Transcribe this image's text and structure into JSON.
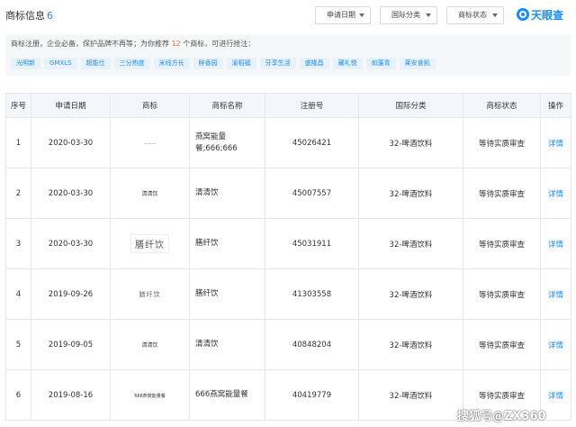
{
  "header": {
    "title": "商标信息",
    "count": "6",
    "filters": [
      {
        "label": "申请日期"
      },
      {
        "label": "国际分类"
      },
      {
        "label": "商标状态"
      }
    ],
    "logo_text": "天眼查"
  },
  "recommend": {
    "text_before": "商标注册，企业必备，保护品牌不再等；为你推荐",
    "count": "12",
    "text_after": "个商标，可进行抢注：",
    "tags": [
      "光明新",
      "GMXLS",
      "超能仕",
      "三分热度",
      "米线方长",
      "醉香园",
      "渝稻福",
      "芬享生活",
      "盛隆昌",
      "藏礼悦",
      "如蓬青",
      "莱安食凯"
    ]
  },
  "table": {
    "columns": [
      "序号",
      "申请日期",
      "商标",
      "商标名称",
      "注册号",
      "国际分类",
      "商标状态",
      "操作"
    ],
    "rows": [
      {
        "index": "1",
        "date": "2020-03-30",
        "mark": "···········",
        "name": "燕窝能量餐;666;666",
        "reg_no": "45026421",
        "category": "32-啤酒饮料",
        "status": "等待实质审查",
        "action": "详情"
      },
      {
        "index": "2",
        "date": "2020-03-30",
        "mark": "清清饮",
        "name": "清清饮",
        "reg_no": "45007557",
        "category": "32-啤酒饮料",
        "status": "等待实质审查",
        "action": "详情"
      },
      {
        "index": "3",
        "date": "2020-03-30",
        "mark": "膳纤饮",
        "name": "膳纤饮",
        "reg_no": "45031911",
        "category": "32-啤酒饮料",
        "status": "等待实质审查",
        "action": "详情"
      },
      {
        "index": "4",
        "date": "2019-09-26",
        "mark": "膳纤饮",
        "name": "膳纤饮",
        "reg_no": "41303558",
        "category": "32-啤酒饮料",
        "status": "等待实质审查",
        "action": "详情"
      },
      {
        "index": "5",
        "date": "2019-09-05",
        "mark": "清清饮",
        "name": "清清饮",
        "reg_no": "40848204",
        "category": "32-啤酒饮料",
        "status": "等待实质审查",
        "action": "详情"
      },
      {
        "index": "6",
        "date": "2019-08-16",
        "mark": "666燕窝能量餐",
        "name": "666燕窝能量餐",
        "reg_no": "40419779",
        "category": "32-啤酒饮料",
        "status": "等待实质审查",
        "action": "详情"
      }
    ]
  },
  "watermark": "搜狐号@ZX360",
  "colors": {
    "accent": "#1a8cff",
    "highlight": "#f56b3a",
    "header_bg": "#f3f6fb"
  }
}
